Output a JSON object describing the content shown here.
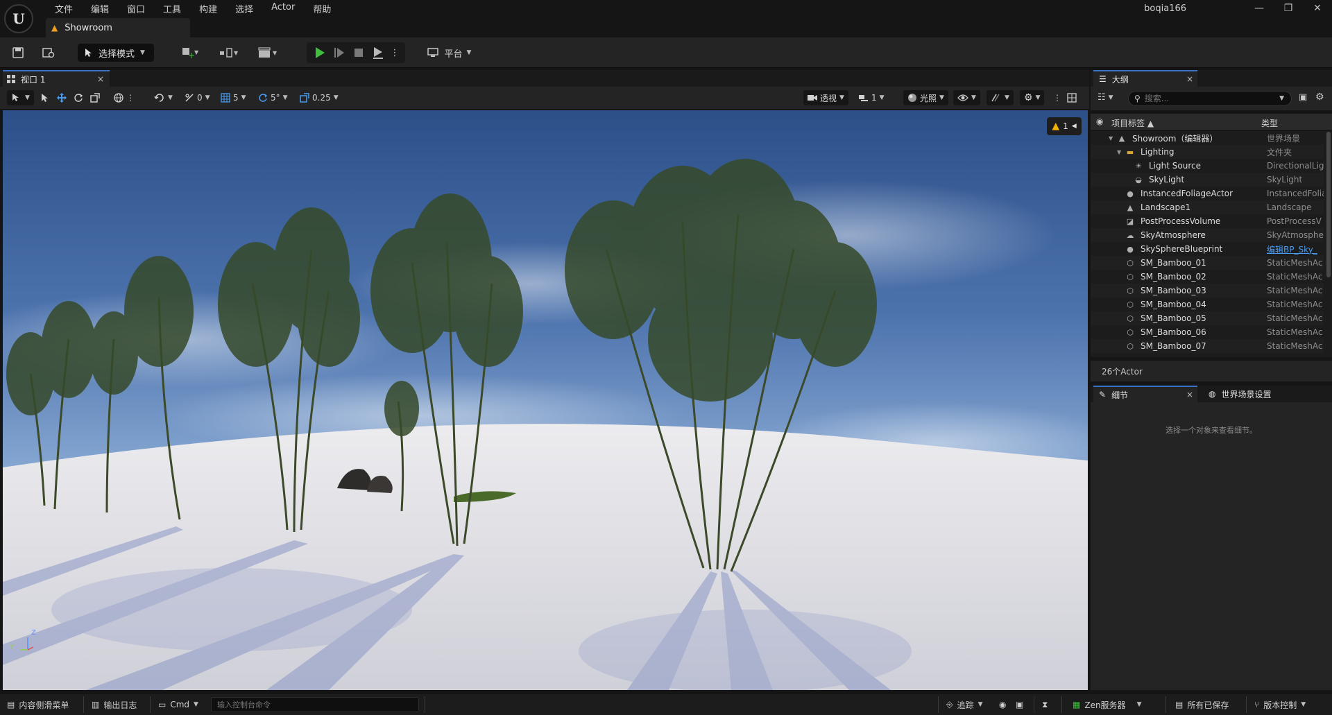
{
  "app": {
    "logo_label": "U",
    "menu": [
      "文件",
      "编辑",
      "窗口",
      "工具",
      "构建",
      "选择",
      "Actor",
      "帮助"
    ],
    "document_tab": "Showroom",
    "user": "boqia166",
    "window_controls": {
      "minimize": "—",
      "restore": "❐",
      "close": "✕"
    }
  },
  "toolbar": {
    "mode_label": "选择模式",
    "platform_label": "平台"
  },
  "viewport": {
    "tab_label": "视口 1",
    "tab_close": "×",
    "tools": {
      "rotate_snap": "0",
      "grid_snap": "5",
      "angle_snap": "5°",
      "scale_snap": "0.25",
      "view_mode": "透视",
      "camera_speed": "1",
      "lit_mode": "光照"
    },
    "warning_count": "1",
    "axis": {
      "z": "Z",
      "y": "Y"
    }
  },
  "outliner": {
    "tab_label": "大纲",
    "tab_close": "×",
    "search_placeholder": "搜索...",
    "col_label": "项目标签 ▲",
    "col_type": "类型",
    "items": [
      {
        "label": "Showroom（编辑器）",
        "type": "世界场景",
        "indent": 0,
        "icon": "world-icon",
        "glyph": "▲",
        "expander": "▼"
      },
      {
        "label": "Lighting",
        "type": "文件夹",
        "indent": 1,
        "icon": "folder-icon",
        "glyph": "▬",
        "expander": "▼"
      },
      {
        "label": "Light Source",
        "type": "DirectionalLig",
        "indent": 2,
        "icon": "directional-light-icon",
        "glyph": "☀",
        "expander": ""
      },
      {
        "label": "SkyLight",
        "type": "SkyLight",
        "indent": 2,
        "icon": "skylight-icon",
        "glyph": "◒",
        "expander": ""
      },
      {
        "label": "InstancedFoliageActor",
        "type": "InstancedFolia",
        "indent": 1,
        "icon": "actor-icon",
        "glyph": "●",
        "expander": ""
      },
      {
        "label": "Landscape1",
        "type": "Landscape",
        "indent": 1,
        "icon": "landscape-icon",
        "glyph": "▲",
        "expander": ""
      },
      {
        "label": "PostProcessVolume",
        "type": "PostProcessV",
        "indent": 1,
        "icon": "volume-icon",
        "glyph": "◪",
        "expander": ""
      },
      {
        "label": "SkyAtmosphere",
        "type": "SkyAtmosphe",
        "indent": 1,
        "icon": "atmosphere-icon",
        "glyph": "☁",
        "expander": ""
      },
      {
        "label": "SkySphereBlueprint",
        "type": "编辑BP_Sky_",
        "indent": 1,
        "icon": "blueprint-icon",
        "glyph": "●",
        "expander": "",
        "link": true
      },
      {
        "label": "SM_Bamboo_01",
        "type": "StaticMeshAc",
        "indent": 1,
        "icon": "static-mesh-icon",
        "glyph": "⬡",
        "expander": ""
      },
      {
        "label": "SM_Bamboo_02",
        "type": "StaticMeshAc",
        "indent": 1,
        "icon": "static-mesh-icon",
        "glyph": "⬡",
        "expander": ""
      },
      {
        "label": "SM_Bamboo_03",
        "type": "StaticMeshAc",
        "indent": 1,
        "icon": "static-mesh-icon",
        "glyph": "⬡",
        "expander": ""
      },
      {
        "label": "SM_Bamboo_04",
        "type": "StaticMeshAc",
        "indent": 1,
        "icon": "static-mesh-icon",
        "glyph": "⬡",
        "expander": ""
      },
      {
        "label": "SM_Bamboo_05",
        "type": "StaticMeshAc",
        "indent": 1,
        "icon": "static-mesh-icon",
        "glyph": "⬡",
        "expander": ""
      },
      {
        "label": "SM_Bamboo_06",
        "type": "StaticMeshAc",
        "indent": 1,
        "icon": "static-mesh-icon",
        "glyph": "⬡",
        "expander": ""
      },
      {
        "label": "SM_Bamboo_07",
        "type": "StaticMeshAc",
        "indent": 1,
        "icon": "static-mesh-icon",
        "glyph": "⬡",
        "expander": ""
      }
    ],
    "footer": "26个Actor"
  },
  "details": {
    "tab_label": "细节",
    "tab_close": "×",
    "world_settings_tab": "世界场景设置",
    "empty_message": "选择一个对象来查看细节。"
  },
  "statusbar": {
    "content_drawer": "内容侧滑菜单",
    "output_log": "输出日志",
    "cmd": "Cmd",
    "console_placeholder": "输入控制台命令",
    "trace": "追踪",
    "zen_server": "Zen服务器",
    "all_saved": "所有已保存",
    "source_control": "版本控制"
  },
  "colors": {
    "accent": "#3a74c8",
    "play_green": "#3fbf3f",
    "warning": "#f0b400",
    "link": "#4a9bf0"
  }
}
